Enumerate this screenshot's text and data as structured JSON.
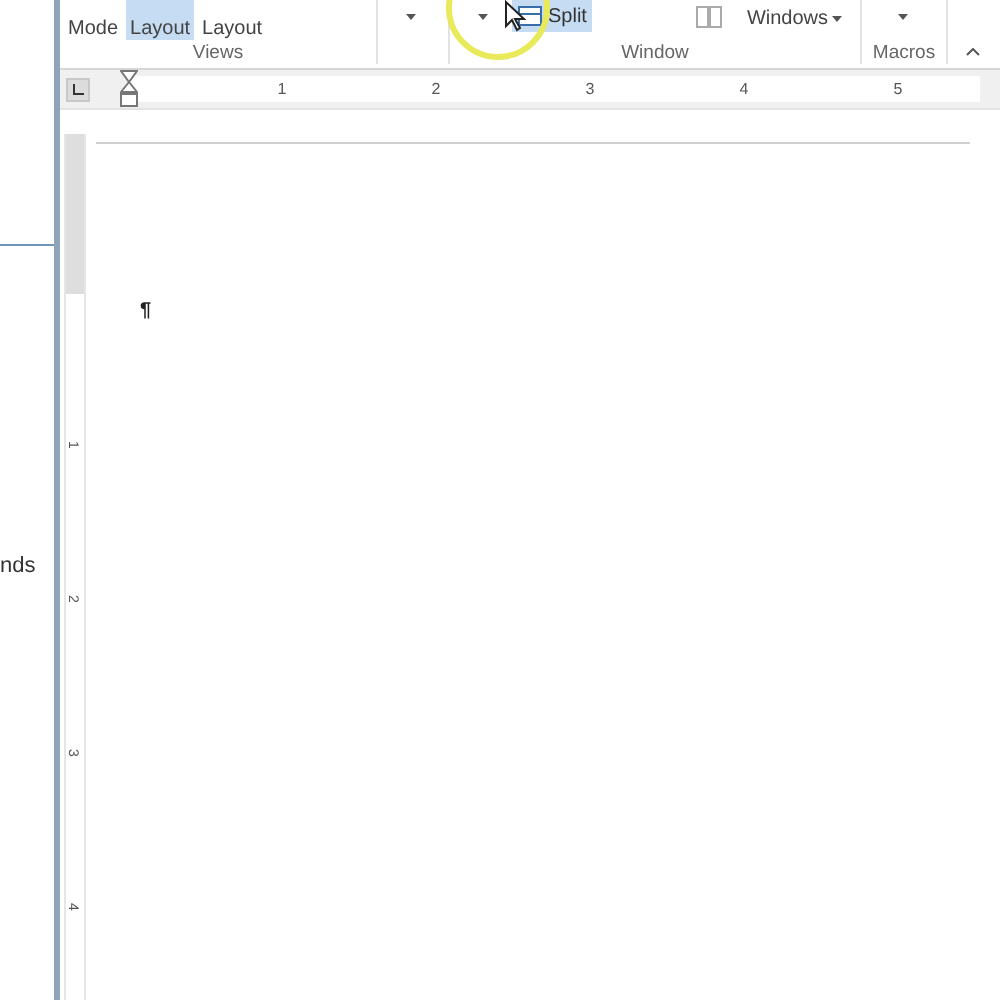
{
  "left_panel": {
    "text": "nds"
  },
  "ribbon": {
    "views": {
      "buttons": [
        {
          "label": "Mode",
          "selected": false
        },
        {
          "label": "Layout",
          "selected": true
        },
        {
          "label": "Layout",
          "selected": false
        }
      ],
      "label": "Views"
    },
    "window": {
      "split": {
        "label": "Split",
        "selected": true
      },
      "switch": {
        "label": "Windows"
      },
      "label": "Window"
    },
    "macros": {
      "label": "Macros"
    }
  },
  "ruler": {
    "numbers": [
      "1",
      "2",
      "3",
      "4",
      "5"
    ]
  },
  "vertical_ruler": {
    "numbers": [
      "1",
      "2",
      "3",
      "4"
    ]
  },
  "document": {
    "paragraph_mark": "¶"
  }
}
